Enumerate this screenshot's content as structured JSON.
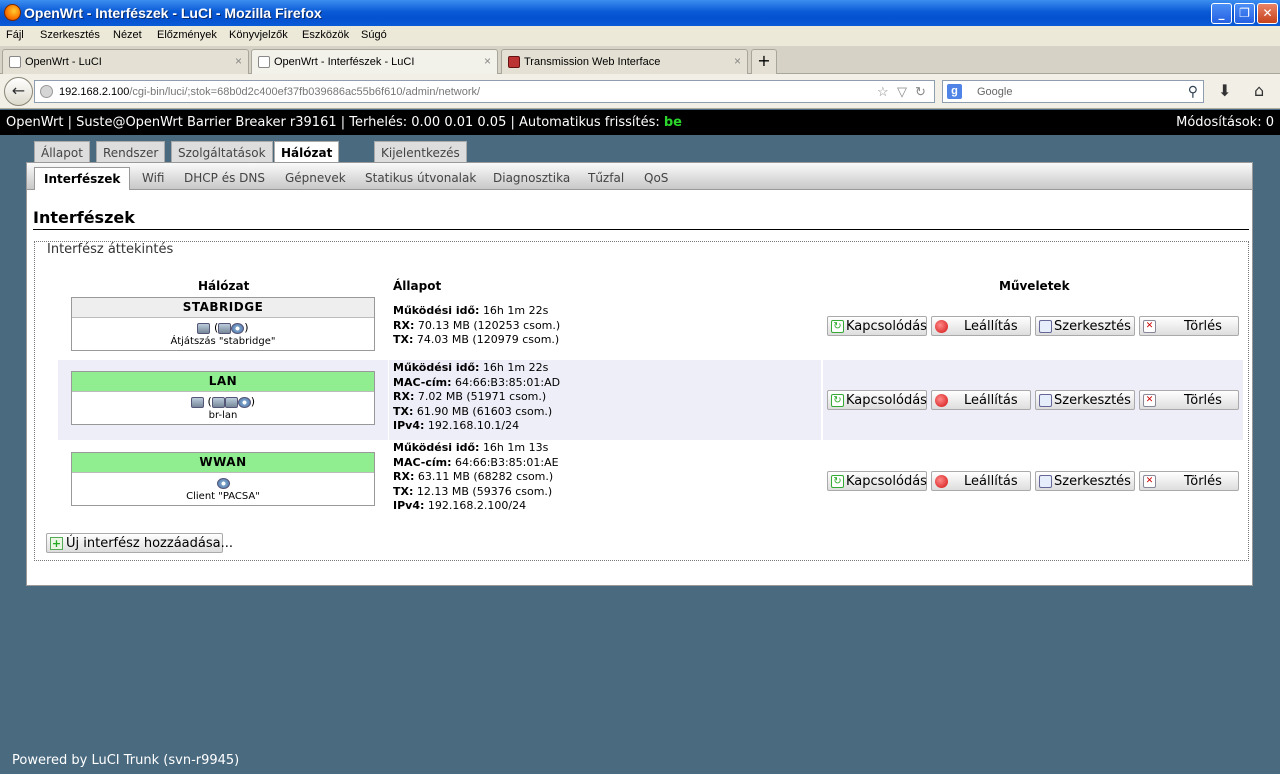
{
  "window": {
    "title": "OpenWrt - Interfészek - LuCI - Mozilla Firefox",
    "minimize": "_",
    "maximize": "❐",
    "close": "✕"
  },
  "menu": [
    "Fájl",
    "Szerkesztés",
    "Nézet",
    "Előzmények",
    "Könyvjelzők",
    "Eszközök",
    "Súgó"
  ],
  "tabs": [
    {
      "label": "OpenWrt - LuCI"
    },
    {
      "label": "OpenWrt - Interfészek - LuCI"
    },
    {
      "label": "Transmission Web Interface"
    }
  ],
  "tab_close": "×",
  "new_tab": "+",
  "nav": {
    "back": "←",
    "url_host": "192.168.2.100",
    "url_rest": "/cgi-bin/luci/;stok=68b0d2c400ef37fb039686ac55b6f610/admin/network/",
    "star": "☆",
    "dropdown": "▽",
    "reload": "↻",
    "search_engine": "g",
    "search_placeholder": "Google",
    "search_icon": "⚲",
    "download": "⬇",
    "home": "⌂"
  },
  "header": {
    "text": "OpenWrt | Suste@OpenWrt Barrier Breaker r39161 | Terhelés: 0.00 0.01 0.05 | Automatikus frissítés: ",
    "refresh_state": "be",
    "changes": "Módosítások: 0"
  },
  "main_tabs": [
    {
      "label": "Állapot"
    },
    {
      "label": "Rendszer"
    },
    {
      "label": "Szolgáltatások"
    },
    {
      "label": "Hálózat"
    },
    {
      "label": "Kijelentkezés"
    }
  ],
  "sub_tabs": [
    {
      "label": "Interfészek"
    },
    {
      "label": "Wifi"
    },
    {
      "label": "DHCP és DNS"
    },
    {
      "label": "Gépnevek"
    },
    {
      "label": "Statikus útvonalak"
    },
    {
      "label": "Diagnosztika"
    },
    {
      "label": "Tűzfal"
    },
    {
      "label": "QoS"
    }
  ],
  "page": {
    "title": "Interfészek",
    "section": "Interfész áttekintés",
    "col_network": "Hálózat",
    "col_status": "Állapot",
    "col_actions": "Műveletek"
  },
  "interfaces": [
    {
      "name": "STABRIDGE",
      "sub": "Átjátszás \"stabridge\"",
      "uptime_label": "Működési idő:",
      "uptime": "16h 1m 22s",
      "rx_label": "RX:",
      "rx": "70.13 MB (120253 csom.)",
      "tx_label": "TX:",
      "tx": "74.03 MB (120979 csom.)"
    },
    {
      "name": "LAN",
      "sub": "br-lan",
      "uptime_label": "Működési idő:",
      "uptime": "16h 1m 22s",
      "mac_label": "MAC-cím:",
      "mac": "64:66:B3:85:01:AD",
      "rx_label": "RX:",
      "rx": "7.02 MB (51971 csom.)",
      "tx_label": "TX:",
      "tx": "61.90 MB (61603 csom.)",
      "ipv4_label": "IPv4:",
      "ipv4": "192.168.10.1/24"
    },
    {
      "name": "WWAN",
      "sub": "Client \"PACSA\"",
      "uptime_label": "Működési idő:",
      "uptime": "16h 1m 13s",
      "mac_label": "MAC-cím:",
      "mac": "64:66:B3:85:01:AE",
      "rx_label": "RX:",
      "rx": "63.11 MB (68282 csom.)",
      "tx_label": "TX:",
      "tx": "12.13 MB (59376 csom.)",
      "ipv4_label": "IPv4:",
      "ipv4": "192.168.2.100/24"
    }
  ],
  "actions": {
    "connect": "Kapcsolódás",
    "stop": "Leállítás",
    "edit": "Szerkesztés",
    "delete": "Törlés"
  },
  "icons": {
    "connect_glyph": "↻",
    "delete_glyph": "✕",
    "add_glyph": "+"
  },
  "add_interface": "Új interfész hozzáadása...",
  "footer": "Powered by LuCI Trunk (svn-r9945)",
  "colors": {
    "header_bg": "#000000",
    "refresh_on": "#2bd52b",
    "iface_up": "#90ee90",
    "page_bg": "#4a6a80"
  }
}
